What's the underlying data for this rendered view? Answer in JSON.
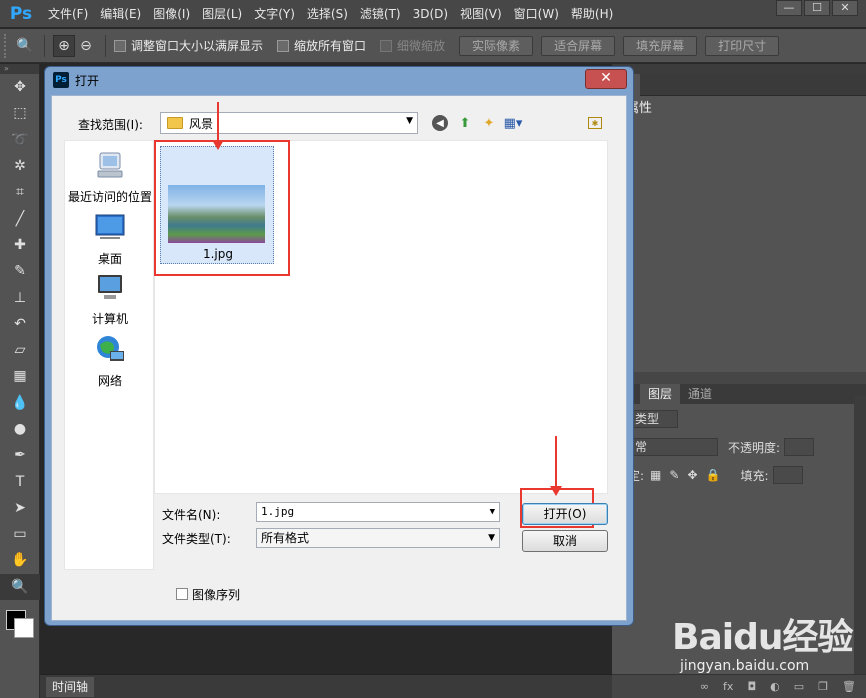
{
  "app": {
    "logo": "Ps",
    "menu": [
      "文件(F)",
      "编辑(E)",
      "图像(I)",
      "图层(L)",
      "文字(Y)",
      "选择(S)",
      "滤镜(T)",
      "3D(D)",
      "视图(V)",
      "窗口(W)",
      "帮助(H)"
    ],
    "window_controls": [
      "—",
      "☐",
      "✕"
    ]
  },
  "options_bar": {
    "checkbox_resize": "调整窗口大小以满屏显示",
    "checkbox_zoom_all": "缩放所有窗口",
    "checkbox_scrubby": "细微缩放",
    "buttons": [
      "实际像素",
      "适合屏幕",
      "填充屏幕",
      "打印尺寸"
    ]
  },
  "panels": {
    "properties_tab": "性",
    "properties_header": "属性",
    "layers_tab": "图层",
    "channels_tab": "通道",
    "kind_label": "类型",
    "blend_mode": "常",
    "opacity_label": "不透明度:",
    "lock_label": "定:",
    "fill_label": "填充:"
  },
  "timeline": {
    "tab": "时间轴"
  },
  "watermark": {
    "logo": "Baidu经验",
    "url": "jingyan.baidu.com"
  },
  "dialog": {
    "title": "打开",
    "close": "✕",
    "look_in_label": "查找范围(I):",
    "look_in_value": "风景",
    "places": [
      {
        "label": "最近访问的位置"
      },
      {
        "label": "桌面"
      },
      {
        "label": "计算机"
      },
      {
        "label": "网络"
      }
    ],
    "files": [
      {
        "name": "1.jpg"
      }
    ],
    "filename_label": "文件名(N):",
    "filename_value": "1.jpg",
    "filetype_label": "文件类型(T):",
    "filetype_value": "所有格式",
    "open_button": "打开(O)",
    "cancel_button": "取消",
    "image_sequence_label": "图像序列"
  },
  "colors": {
    "accent_red": "#e8382f",
    "ps_blue": "#31a8ff",
    "dialog_frame": "#7da2ce"
  }
}
